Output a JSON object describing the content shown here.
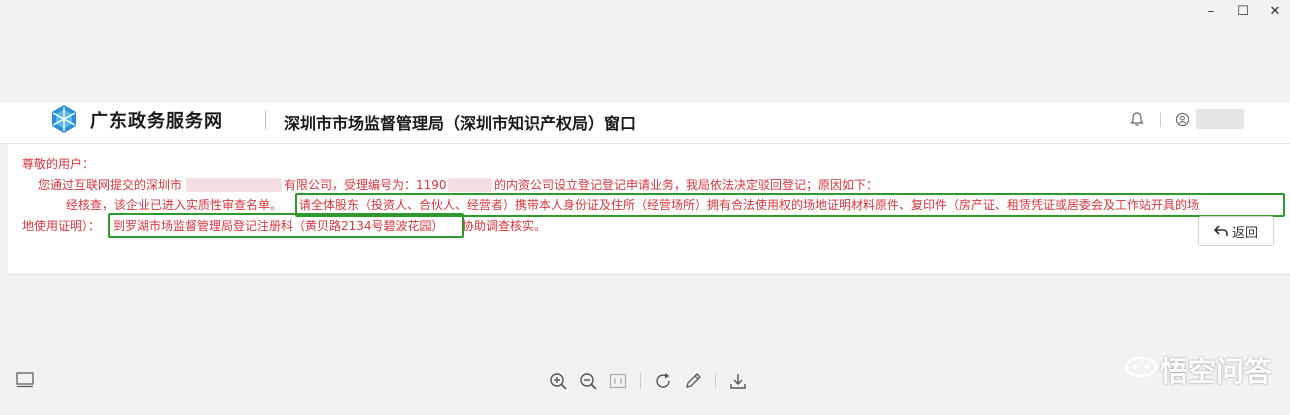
{
  "window": {
    "controls": {
      "minimize": "–",
      "maximize": "☐",
      "close": "✕"
    }
  },
  "header": {
    "brand": "广东政务服务网",
    "office": "深圳市市场监督管理局（深圳市知识产权局）窗口"
  },
  "message": {
    "greeting": "尊敬的用户：",
    "line1_a": "您通过互联网提交的深圳市",
    "line1_b": "有限公司，受理编号为：1190",
    "line1_c": "的内资公司设立登记登记申请业务，我局依法决定驳回登记；原因如下：",
    "line2_a": "经核查，该企业已进入实质性审查名单。",
    "line2_b": "请全体股东（投资人、合伙人、经营者）携带本人身份证及住所（经营场所）拥有合法使用权的场地证明材料原件、复印件（房产证、租赁凭证或居委会及工作站开具的场",
    "line3_a": "地使用证明）：",
    "line3_b": "到罗湖市场监督管理局登记注册科（黄贝路2134号碧波花园）",
    "line3_c": "协助调查核实。"
  },
  "actions": {
    "back_label": "返回"
  },
  "watermark": {
    "text": "悟空问答"
  },
  "colors": {
    "message": "#d9363e",
    "highlight": "#2e9a2e"
  }
}
